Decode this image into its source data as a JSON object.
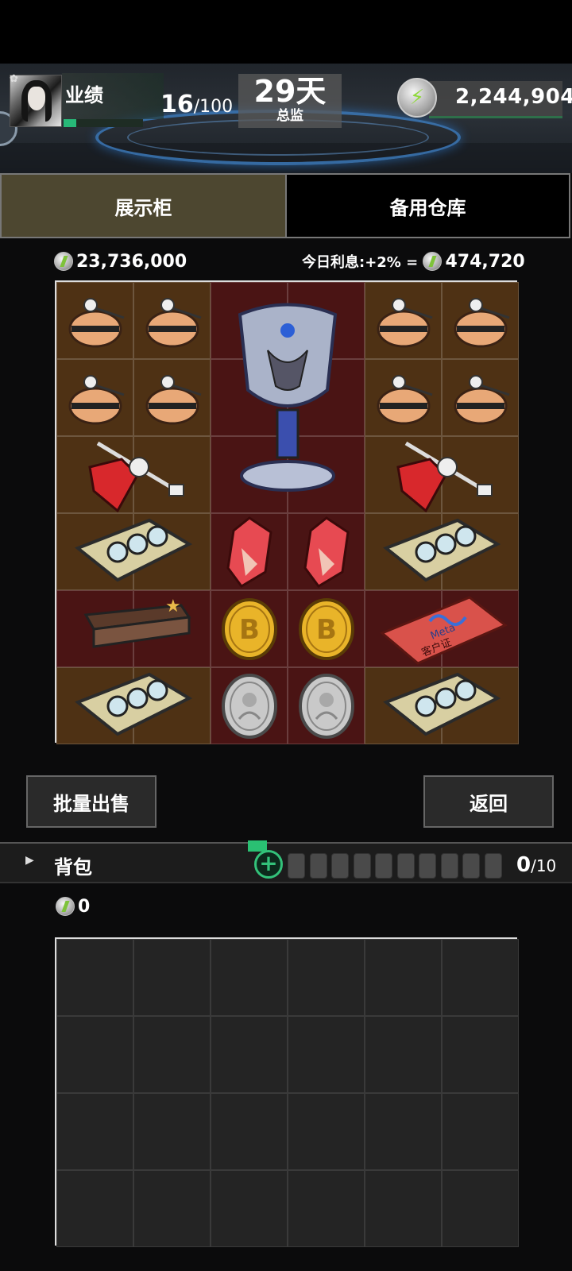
{
  "header": {
    "performance_label": "业绩",
    "performance_value": "16",
    "performance_max": "/100",
    "performance_fraction": 0.16,
    "day_count": "29天",
    "rank": "总监",
    "energy": "2,244,904"
  },
  "tabs": [
    {
      "label": "展示柜",
      "active": true
    },
    {
      "label": "备用仓库",
      "active": false
    }
  ],
  "showcase": {
    "total_value": "23,736,000",
    "interest_label": "今日利息:+2% =",
    "interest_value": "474,720",
    "items": [
      {
        "name": "pouch",
        "row": 0,
        "col": 0
      },
      {
        "name": "pouch",
        "row": 0,
        "col": 1
      },
      {
        "name": "trophy",
        "row": 0,
        "col": 2
      },
      {
        "name": "pouch",
        "row": 0,
        "col": 4
      },
      {
        "name": "pouch",
        "row": 0,
        "col": 5
      },
      {
        "name": "pouch",
        "row": 1,
        "col": 0
      },
      {
        "name": "pouch",
        "row": 1,
        "col": 1
      },
      {
        "name": "pouch",
        "row": 1,
        "col": 4
      },
      {
        "name": "pouch",
        "row": 1,
        "col": 5
      },
      {
        "name": "ruby-pendant",
        "row": 2,
        "col": 0
      },
      {
        "name": "ruby-pendant",
        "row": 2,
        "col": 4
      },
      {
        "name": "gpu-card",
        "row": 3,
        "col": 0
      },
      {
        "name": "red-crystal",
        "row": 3,
        "col": 2
      },
      {
        "name": "red-crystal",
        "row": 3,
        "col": 3
      },
      {
        "name": "gpu-card",
        "row": 3,
        "col": 4
      },
      {
        "name": "gift-box",
        "row": 4,
        "col": 0
      },
      {
        "name": "bitcoin",
        "row": 4,
        "col": 2
      },
      {
        "name": "bitcoin",
        "row": 4,
        "col": 3
      },
      {
        "name": "meta-card",
        "row": 4,
        "col": 4
      },
      {
        "name": "gpu-card",
        "row": 5,
        "col": 0
      },
      {
        "name": "silver-coin",
        "row": 5,
        "col": 2
      },
      {
        "name": "silver-coin",
        "row": 5,
        "col": 3
      },
      {
        "name": "gpu-card",
        "row": 5,
        "col": 4
      }
    ],
    "meta_card_text": "Meta",
    "meta_card_sub": "客户证"
  },
  "actions": {
    "sell_label": "批量出售",
    "back_label": "返回"
  },
  "bag": {
    "label": "背包",
    "count": "0",
    "max": "/10",
    "money": "0"
  },
  "colors": {
    "accent_green": "#27b878",
    "tab_active": "#4d4730",
    "cell_brown": "#4e3114",
    "cell_maroon": "#4a1414"
  }
}
